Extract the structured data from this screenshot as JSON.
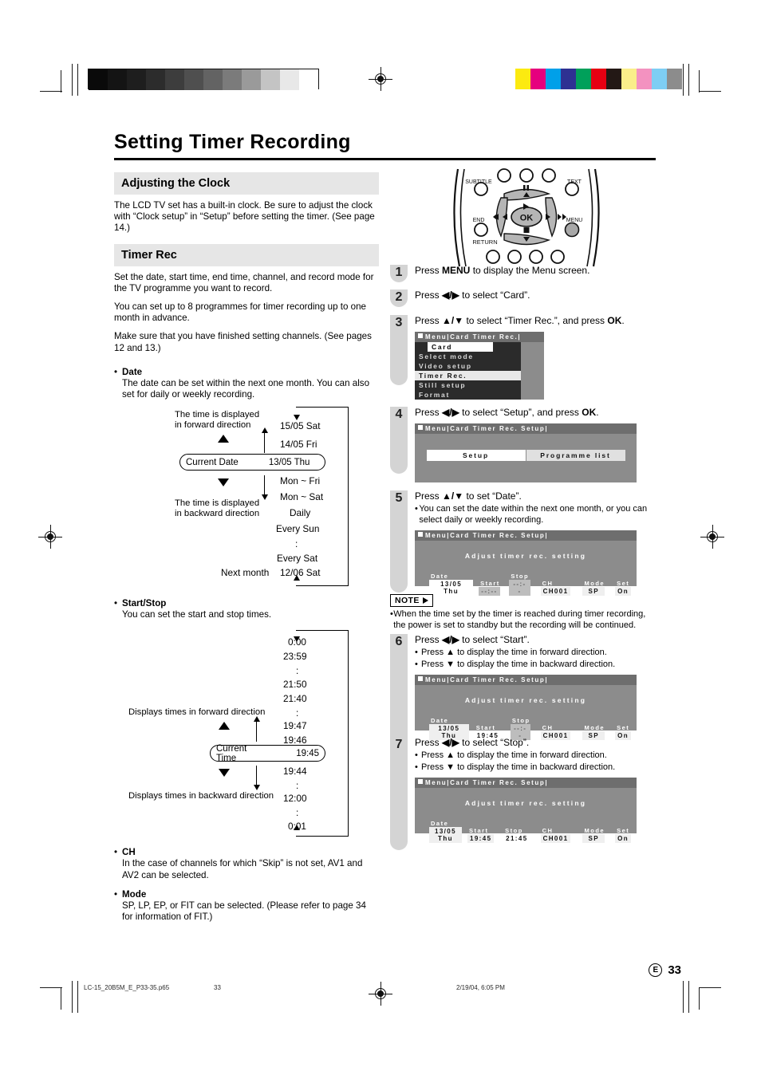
{
  "document": {
    "title": "Setting Timer Recording",
    "page_number": "33",
    "page_region": "E",
    "footer": {
      "filename": "LC-15_20B5M_E_P33-35.p65",
      "page": "33",
      "timestamp": "2/19/04, 6:05 PM"
    }
  },
  "left": {
    "section_clock": {
      "heading": "Adjusting the Clock",
      "paragraph": "The LCD TV set has a built-in clock. Be sure to adjust the clock with “Clock setup” in “Setup” before setting the timer. (See page 14.)"
    },
    "section_timer": {
      "heading": "Timer Rec",
      "paragraph1": "Set the date, start time, end time, channel, and record mode for the TV programme you want to record.",
      "paragraph2": "You can set up to 8 programmes for timer recording up to one month in advance.",
      "paragraph3": "Make sure that you have finished setting channels. (See pages 12 and 13.)"
    },
    "date_item": {
      "bullet": "•",
      "title": "Date",
      "text": "The date can be set within the next one month. You can also set for daily or weekly recording.",
      "label_forward": "The time is displayed\nin forward direction",
      "label_backward": "The time is displayed\nin backward direction",
      "label_forward_l1": "The time is displayed",
      "label_forward_l2": "in forward direction",
      "label_backward_l1": "The time is displayed",
      "label_backward_l2": "in backward direction",
      "current_label": "Current Date",
      "current_value": "13/05 Thu",
      "next_month_label": "Next month",
      "values_above": [
        "15/05 Sat",
        "14/05 Fri"
      ],
      "values_below": [
        "Mon ~ Fri",
        "Mon ~ Sat",
        "Daily",
        "Every Sun",
        ":",
        "Every Sat"
      ],
      "value_last": "12/06 Sat"
    },
    "startstop_item": {
      "bullet": "•",
      "title": "Start/Stop",
      "text": "You can set the start and stop times.",
      "label_forward": "Displays times in forward direction",
      "label_backward": "Displays times in backward direction",
      "current_label": "Current Time",
      "current_value": "19:45",
      "values_above": [
        "0:00",
        "23:59",
        ":",
        "21:50",
        "21:40",
        ":",
        "19:47",
        "19:46"
      ],
      "values_below": [
        "19:44",
        ":",
        "12:00",
        ":",
        "0:01"
      ]
    },
    "ch_item": {
      "bullet": "•",
      "title": "CH",
      "text": "In the case of channels for which “Skip” is not set, AV1 and AV2 can be selected."
    },
    "mode_item": {
      "bullet": "•",
      "title": "Mode",
      "text": "SP, LP, EP, or FIT can be selected. (Please refer to page 34 for information of FIT.)"
    }
  },
  "remote": {
    "label_subtitle": "SUBTITLE",
    "label_text": "TEXT",
    "label_end": "END",
    "label_menu": "MENU",
    "label_return": "RETURN",
    "label_ok": "OK"
  },
  "steps": [
    {
      "number": "1",
      "text_pre": "Press ",
      "bold": "MENU",
      "text_post": " to display the Menu screen."
    },
    {
      "number": "2",
      "text_pre": "Press ",
      "keys": "◀/▶",
      "text_post": " to select “Card”."
    },
    {
      "number": "3",
      "text_pre": "Press ",
      "keys": "▲/▼",
      "text_mid": " to select “Timer Rec.”, and press ",
      "bold": "OK",
      "text_post": "."
    },
    {
      "number": "4",
      "text_pre": "Press ",
      "keys": "◀/▶",
      "text_mid": " to select “Setup”, and press ",
      "bold": "OK",
      "text_post": "."
    },
    {
      "number": "5",
      "text_pre": "Press ",
      "keys": "▲/▼",
      "text_post": " to set “Date”.",
      "sub1": "You can set the date within the next one month, or you can select daily or weekly recording."
    },
    {
      "number": "6",
      "text_pre": "Press ",
      "keys": "◀/▶",
      "text_post": " to select “Start”.",
      "sub1": "Press ▲ to display the time in forward direction.",
      "sub2": "Press ▼ to display the time in backward direction."
    },
    {
      "number": "7",
      "text_pre": "Press ",
      "keys": "◀/▶",
      "text_post": " to select “Stop”.",
      "sub1": "Press ▲ to display the time in forward direction.",
      "sub2": "Press ▼ to display the time in backward direction."
    }
  ],
  "osd": {
    "menu_screen": {
      "titlebar": "Menu|Card Timer Rec.|",
      "header": "Card",
      "items": [
        {
          "label": "Select mode",
          "selected": false
        },
        {
          "label": "Video setup",
          "selected": false
        },
        {
          "label": "Timer Rec.",
          "selected": true
        },
        {
          "label": "Still setup",
          "selected": false
        },
        {
          "label": "Format",
          "selected": false
        }
      ]
    },
    "setup_screen": {
      "titlebar": "Menu|Card Timer Rec. Setup|",
      "button_setup": "Setup",
      "button_list": "Programme list"
    },
    "adjust_common": {
      "titlebar": "Menu|Card Timer Rec. Setup|",
      "title": "Adjust timer rec. setting",
      "headers": {
        "date": "Date",
        "start": "Start",
        "stop": "Stop",
        "ch": "CH",
        "mode": "Mode",
        "set": "Set"
      }
    },
    "step5_row": {
      "date": "13/05 Thu",
      "start": "--:--",
      "stop": "--:--",
      "ch": "CH001",
      "mode": "SP",
      "set": "On"
    },
    "step6_row": {
      "date": "13/05 Thu",
      "start": "19:45",
      "stop": "--:--",
      "ch": "CH001",
      "mode": "SP",
      "set": "On"
    },
    "step7_row": {
      "date": "13/05 Thu",
      "start": "19:45",
      "stop": "21:45",
      "ch": "CH001",
      "mode": "SP",
      "set": "On"
    }
  },
  "note": {
    "label": "NOTE",
    "bullet": "•",
    "text": "When the time set by the timer is reached during timer recording, the power is set to standby but the recording will be continued."
  },
  "print_marks": {
    "gray_swatches": [
      "#0a0a0a",
      "#141414",
      "#1e1e1e",
      "#2c2c2c",
      "#3d3d3d",
      "#4f4f4f",
      "#636363",
      "#7b7b7b",
      "#9a9a9a",
      "#c4c4c4",
      "#e8e8e8",
      "#ffffff"
    ],
    "color_swatches": [
      "#fcea10",
      "#e6007e",
      "#00a0e9",
      "#2e3192",
      "#00a05a",
      "#e60012",
      "#231815",
      "#faee8a",
      "#f392c0",
      "#7ecef4",
      "#8c8c8c"
    ]
  }
}
